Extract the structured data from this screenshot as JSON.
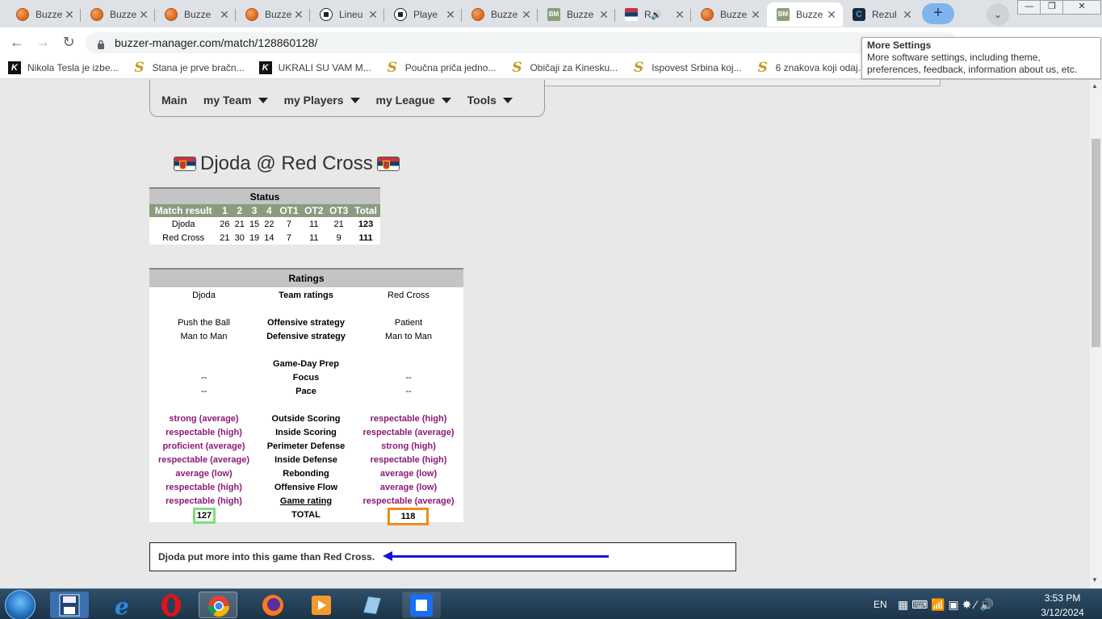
{
  "browser": {
    "tabs": [
      {
        "label": "Buzze",
        "icon": "basketball-icon",
        "active": false
      },
      {
        "label": "Buzze",
        "icon": "basketball-icon",
        "active": false
      },
      {
        "label": "Buzze",
        "icon": "basketball-icon",
        "active": false
      },
      {
        "label": "Buzze",
        "icon": "basketball-icon",
        "active": false
      },
      {
        "label": "Lineu",
        "icon": "soccer-ball-icon",
        "active": false
      },
      {
        "label": "Playe",
        "icon": "soccer-ball-icon",
        "active": false
      },
      {
        "label": "Buzze",
        "icon": "basketball-icon",
        "active": false
      },
      {
        "label": "Buzze",
        "icon": "bm-icon",
        "active": false
      },
      {
        "label": "R",
        "icon": "flag-icon",
        "active": false
      },
      {
        "label": "Buzze",
        "icon": "basketball-icon",
        "active": false
      },
      {
        "label": "Buzze",
        "icon": "bm-icon",
        "active": true
      },
      {
        "label": "Rezul",
        "icon": "c-icon",
        "active": false
      }
    ],
    "url": "buzzer-manager.com/match/128860128/",
    "bookmarks": [
      {
        "label": "Nikola Tesla je izbe...",
        "icon": "k-icon"
      },
      {
        "label": "Stana je prve bračn...",
        "icon": "s-icon"
      },
      {
        "label": "UKRALI SU VAM M...",
        "icon": "k-icon"
      },
      {
        "label": "Poučna priča jedno...",
        "icon": "s-icon"
      },
      {
        "label": "Običaji za Kinesku...",
        "icon": "s-icon"
      },
      {
        "label": "Ispovest Srbina koj...",
        "icon": "s-icon"
      },
      {
        "label": "6 znakova koji odaj...",
        "icon": "s-icon"
      }
    ],
    "tooltip": {
      "title": "More Settings",
      "text": "More software settings, including theme, preferences, feedback, information about us, etc."
    }
  },
  "nav": {
    "main": "Main",
    "team": "my Team",
    "players": "my Players",
    "league": "my League",
    "tools": "Tools"
  },
  "match": {
    "title": "Djoda @ Red Cross"
  },
  "status": {
    "header": "Status",
    "columns": [
      "Match result",
      "1",
      "2",
      "3",
      "4",
      "OT1",
      "OT2",
      "OT3",
      "Total"
    ],
    "rows": [
      {
        "team": "Djoda",
        "q": [
          "26",
          "21",
          "15",
          "22",
          "7",
          "11",
          "21"
        ],
        "total": "123"
      },
      {
        "team": "Red Cross",
        "q": [
          "21",
          "30",
          "19",
          "14",
          "7",
          "11",
          "9"
        ],
        "total": "111"
      }
    ]
  },
  "ratings": {
    "header": "Ratings",
    "home": "Djoda",
    "away": "Red Cross",
    "team_ratings": "Team ratings",
    "off_label": "Offensive strategy",
    "def_label": "Defensive strategy",
    "home_off": "Push the Ball",
    "home_def": "Man to Man",
    "away_off": "Patient",
    "away_def": "Man to Man",
    "prep_label": "Game-Day Prep",
    "focus_label": "Focus",
    "pace_label": "Pace",
    "home_focus": "--",
    "home_pace": "--",
    "away_focus": "--",
    "away_pace": "--",
    "skills": [
      {
        "label": "Outside Scoring",
        "home": "strong (average)",
        "away": "respectable (high)"
      },
      {
        "label": "Inside Scoring",
        "home": "respectable (high)",
        "away": "respectable (average)"
      },
      {
        "label": "Perimeter Defense",
        "home": "proficient (average)",
        "away": "strong (high)"
      },
      {
        "label": "Inside Defense",
        "home": "respectable (average)",
        "away": "respectable (high)"
      },
      {
        "label": "Rebonding",
        "home": "average (low)",
        "away": "average (low)"
      },
      {
        "label": "Offensive Flow",
        "home": "respectable (high)",
        "away": "average (low)"
      },
      {
        "label": "Game rating",
        "home": "respectable (high)",
        "away": "respectable (average)"
      }
    ],
    "total_label": "TOTAL",
    "home_total": "127",
    "away_total": "118"
  },
  "summary": "Djoda put more into this game than Red Cross.",
  "taskbar": {
    "lang": "EN",
    "time": "3:53 PM",
    "date": "3/12/2024"
  },
  "colors": {
    "accent_purple": "#8b1a78",
    "arrow_blue": "#1414d6",
    "home_box": "#7ce07c",
    "away_box": "#f08a1c"
  }
}
